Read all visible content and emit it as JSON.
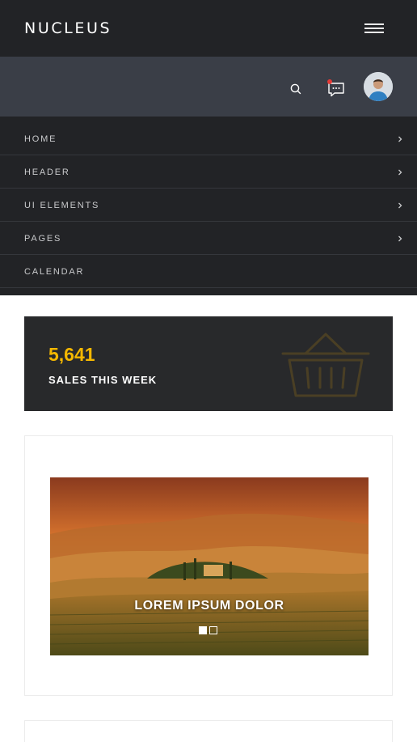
{
  "header": {
    "brand": "NUCLEUS",
    "menu_icon": "hamburger-menu-icon"
  },
  "toolbar": {
    "search_icon": "search-icon",
    "chat_icon": "chat-bubble-icon",
    "has_notification": true,
    "avatar": "user-avatar"
  },
  "nav": {
    "items": [
      {
        "label": "HOME",
        "has_chevron": true
      },
      {
        "label": "HEADER",
        "has_chevron": true
      },
      {
        "label": "UI ELEMENTS",
        "has_chevron": true
      },
      {
        "label": "PAGES",
        "has_chevron": true
      },
      {
        "label": "CALENDAR",
        "has_chevron": false
      }
    ]
  },
  "stat": {
    "value": "5,641",
    "label": "SALES THIS WEEK",
    "icon": "shopping-basket-icon",
    "accent": "#f5b800"
  },
  "slider": {
    "caption": "LOREM IPSUM DOLOR",
    "slide_count": 2,
    "active_slide": 1
  },
  "colors": {
    "topbar": "#222326",
    "subbar": "#3a3e47",
    "nav": "#222326",
    "stat_card": "#28292b",
    "notification": "#e53935"
  }
}
